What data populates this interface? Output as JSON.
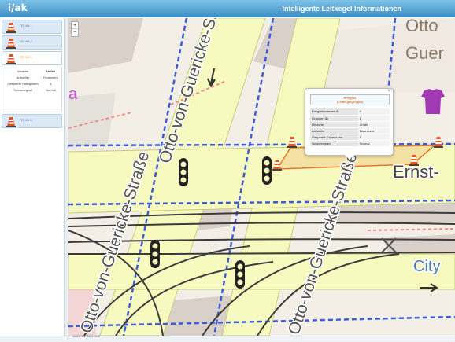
{
  "app": {
    "logo": "i/ak",
    "title": "Intelligente Leitkegel Informationen"
  },
  "sidebar": {
    "items": [
      {
        "label": "ITC Kit 1"
      },
      {
        "label": "ITC Kit 2"
      },
      {
        "label": "ITC Kit 3"
      },
      {
        "label": "ITC Kit 3"
      }
    ],
    "details": [
      {
        "key": "Ursache",
        "value": "Unfall"
      },
      {
        "key": "Aufsteller",
        "value": "Feuerwehr"
      },
      {
        "key": "Gesperrte Fahrspuren",
        "value": "1"
      },
      {
        "key": "Schweregrad",
        "value": "Normal"
      }
    ]
  },
  "map": {
    "streets": [
      "Otto-von-Guericke-Straße",
      "Otto-von-Guericke-Straße",
      "Ernst-",
      "City"
    ],
    "places": [
      "Otto",
      "Guer"
    ],
    "zoom_in": "+",
    "zoom_out": "−",
    "coords": "11.62753, 52.11439"
  },
  "popup": {
    "close": "×",
    "title_line1": "Ereignis",
    "title_line2": "(Leitkegelgruppe)",
    "rows": [
      {
        "key": "Ereignisnummer-ID",
        "value": "0"
      },
      {
        "key": "Gruppen-ID",
        "value": "1"
      },
      {
        "key": "Ursache",
        "value": "Unfall"
      },
      {
        "key": "Aufsteller",
        "value": "Feuerwehr"
      },
      {
        "key": "Gesperrte Fahrspuren",
        "value": "1"
      },
      {
        "key": "Schweregrad",
        "value": "Normal"
      }
    ]
  },
  "colors": {
    "header_top": "#7fc4ea",
    "header_bottom": "#3f8fc4",
    "cone": "#e8541e",
    "polygon": "#e8762a",
    "road_yellow": "#f7fabf",
    "tram": "#3c3c3c"
  }
}
